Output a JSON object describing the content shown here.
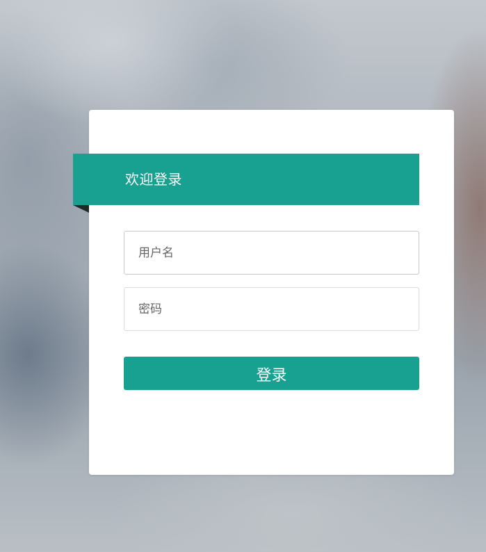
{
  "login": {
    "title": "欢迎登录",
    "username_placeholder": "用户名",
    "username_value": "",
    "password_placeholder": "密码",
    "password_value": "",
    "submit_label": "登录"
  },
  "colors": {
    "accent": "#18a091",
    "card_background": "#ffffff",
    "ribbon_fold": "#1f2a28"
  }
}
